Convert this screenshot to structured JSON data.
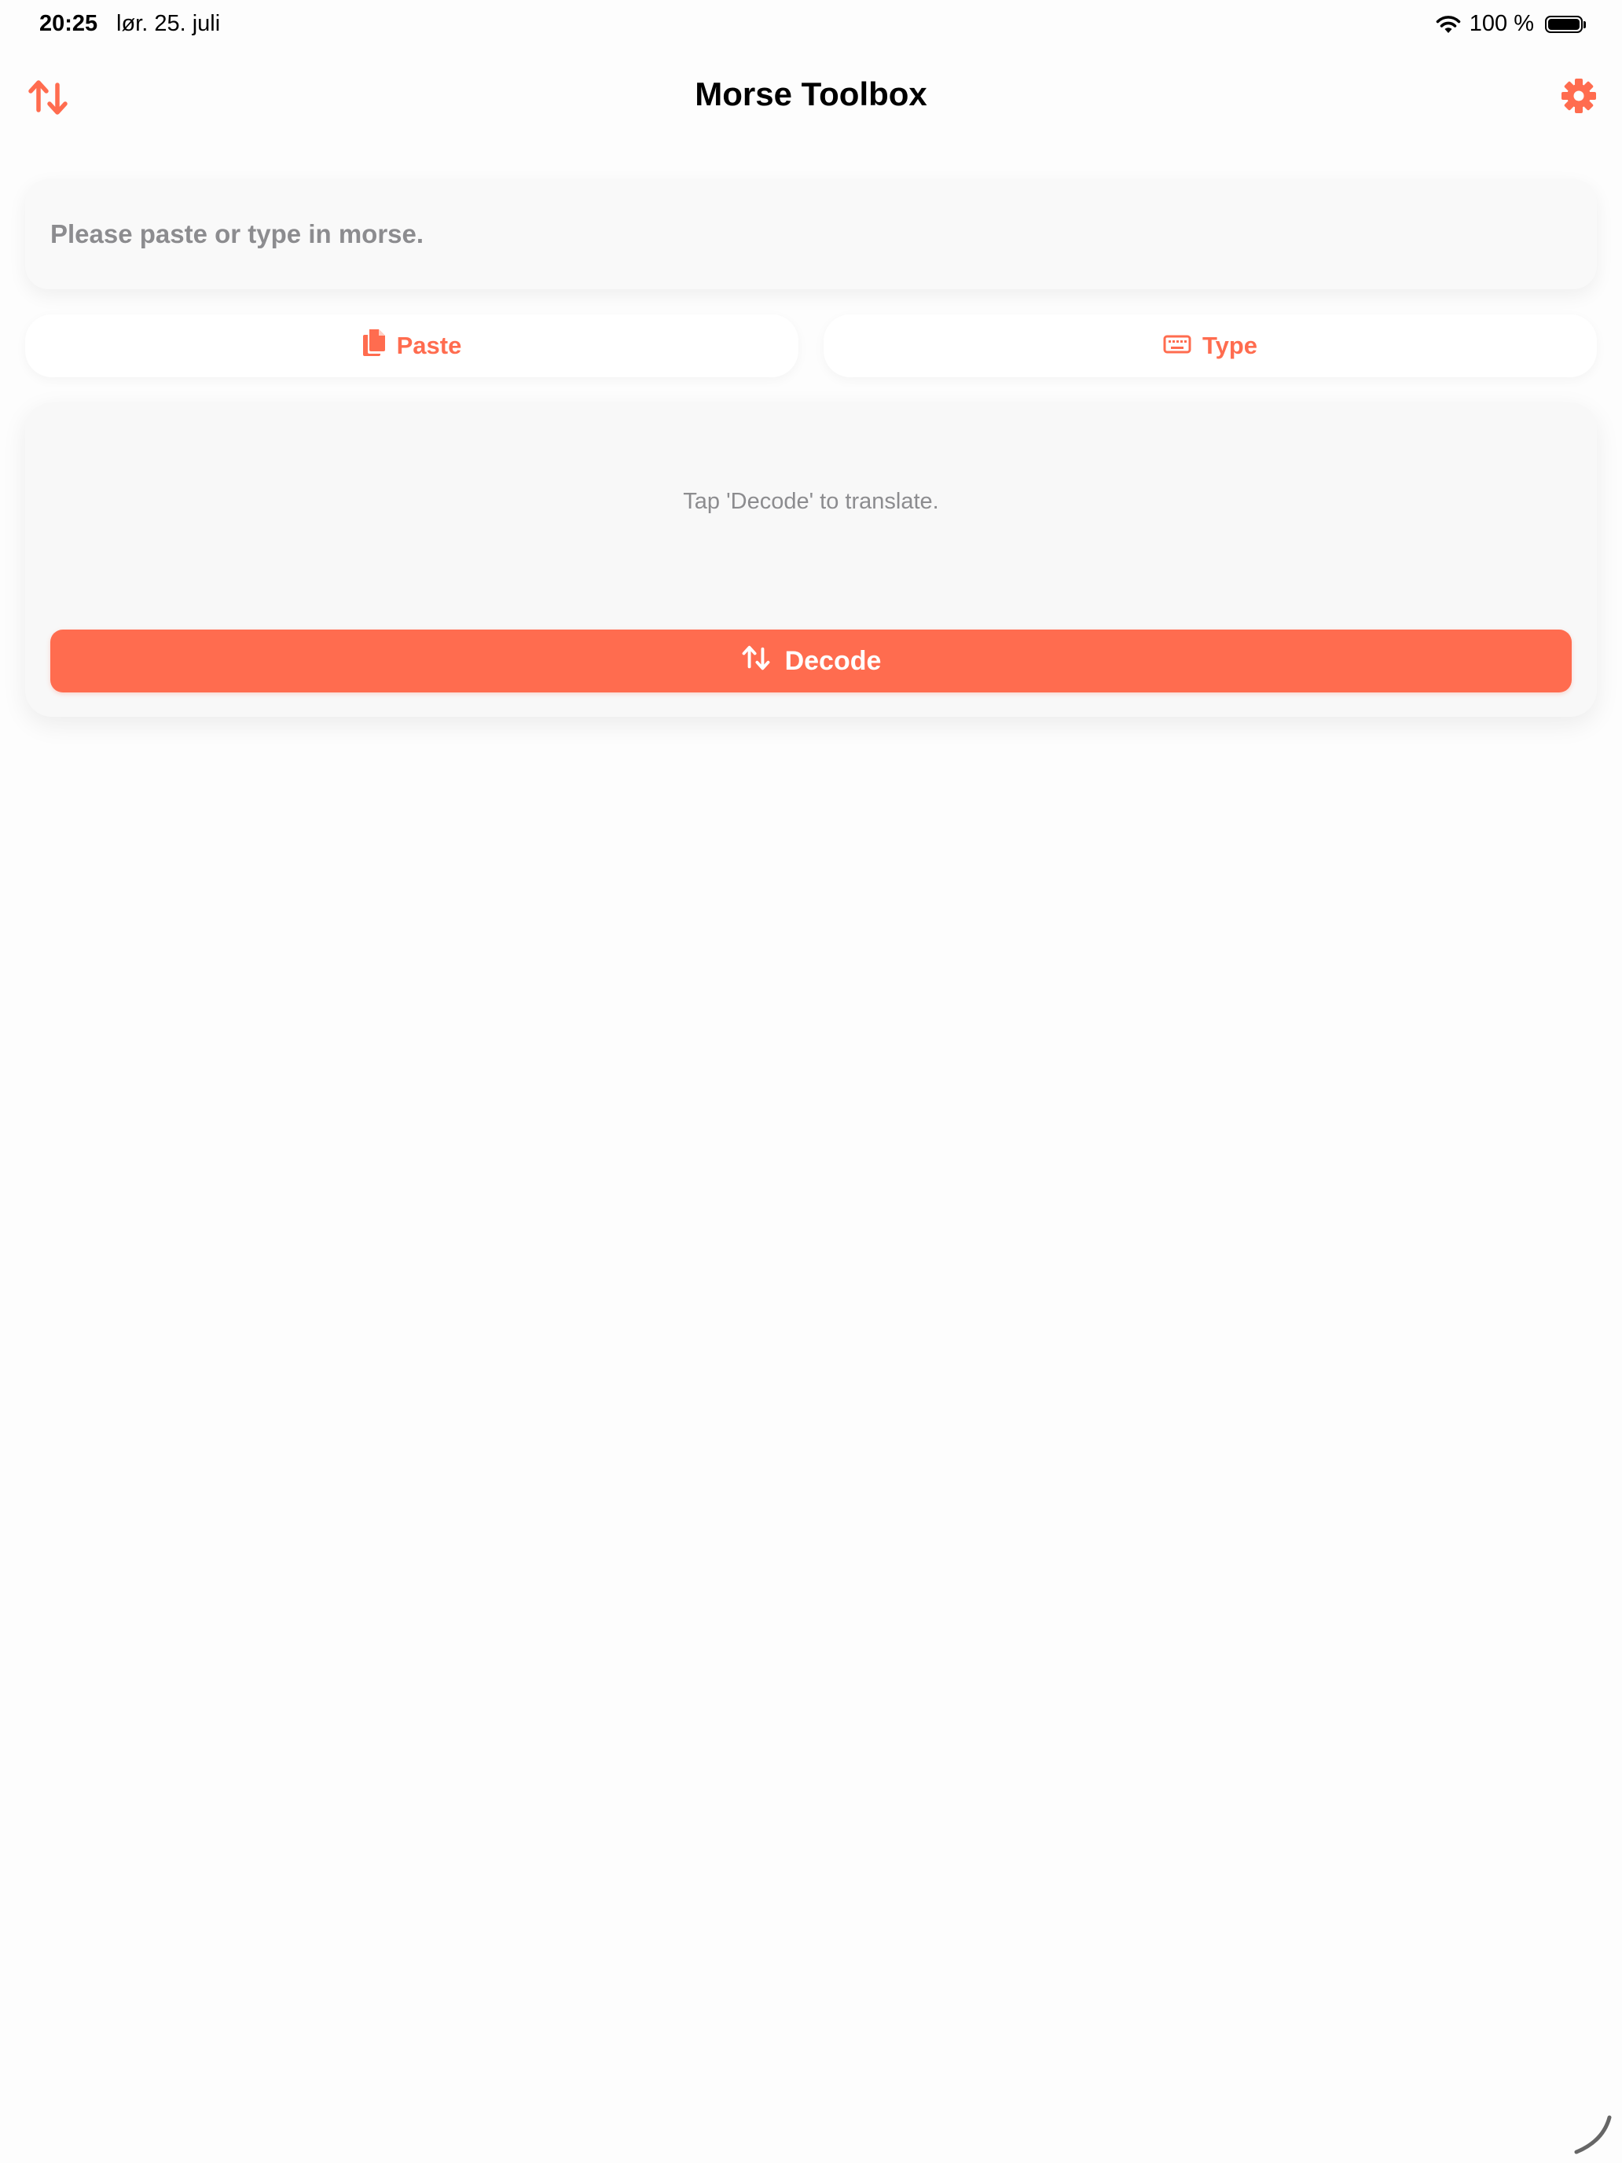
{
  "status_bar": {
    "time": "20:25",
    "date": "lør. 25. juli",
    "battery": "100 %",
    "battery_level": 1.0
  },
  "nav": {
    "title": "Morse Toolbox",
    "left_icon": "swap-arrows-icon",
    "right_icon": "gear-icon"
  },
  "input": {
    "placeholder": "Please paste or type in morse."
  },
  "actions": {
    "paste_label": "Paste",
    "type_label": "Type"
  },
  "result": {
    "hint": "Tap 'Decode' to translate.",
    "decode_label": "Decode"
  },
  "colors": {
    "accent": "#ff6c4f",
    "placeholder": "#8c8c8f",
    "background": "#fdfdfd"
  }
}
